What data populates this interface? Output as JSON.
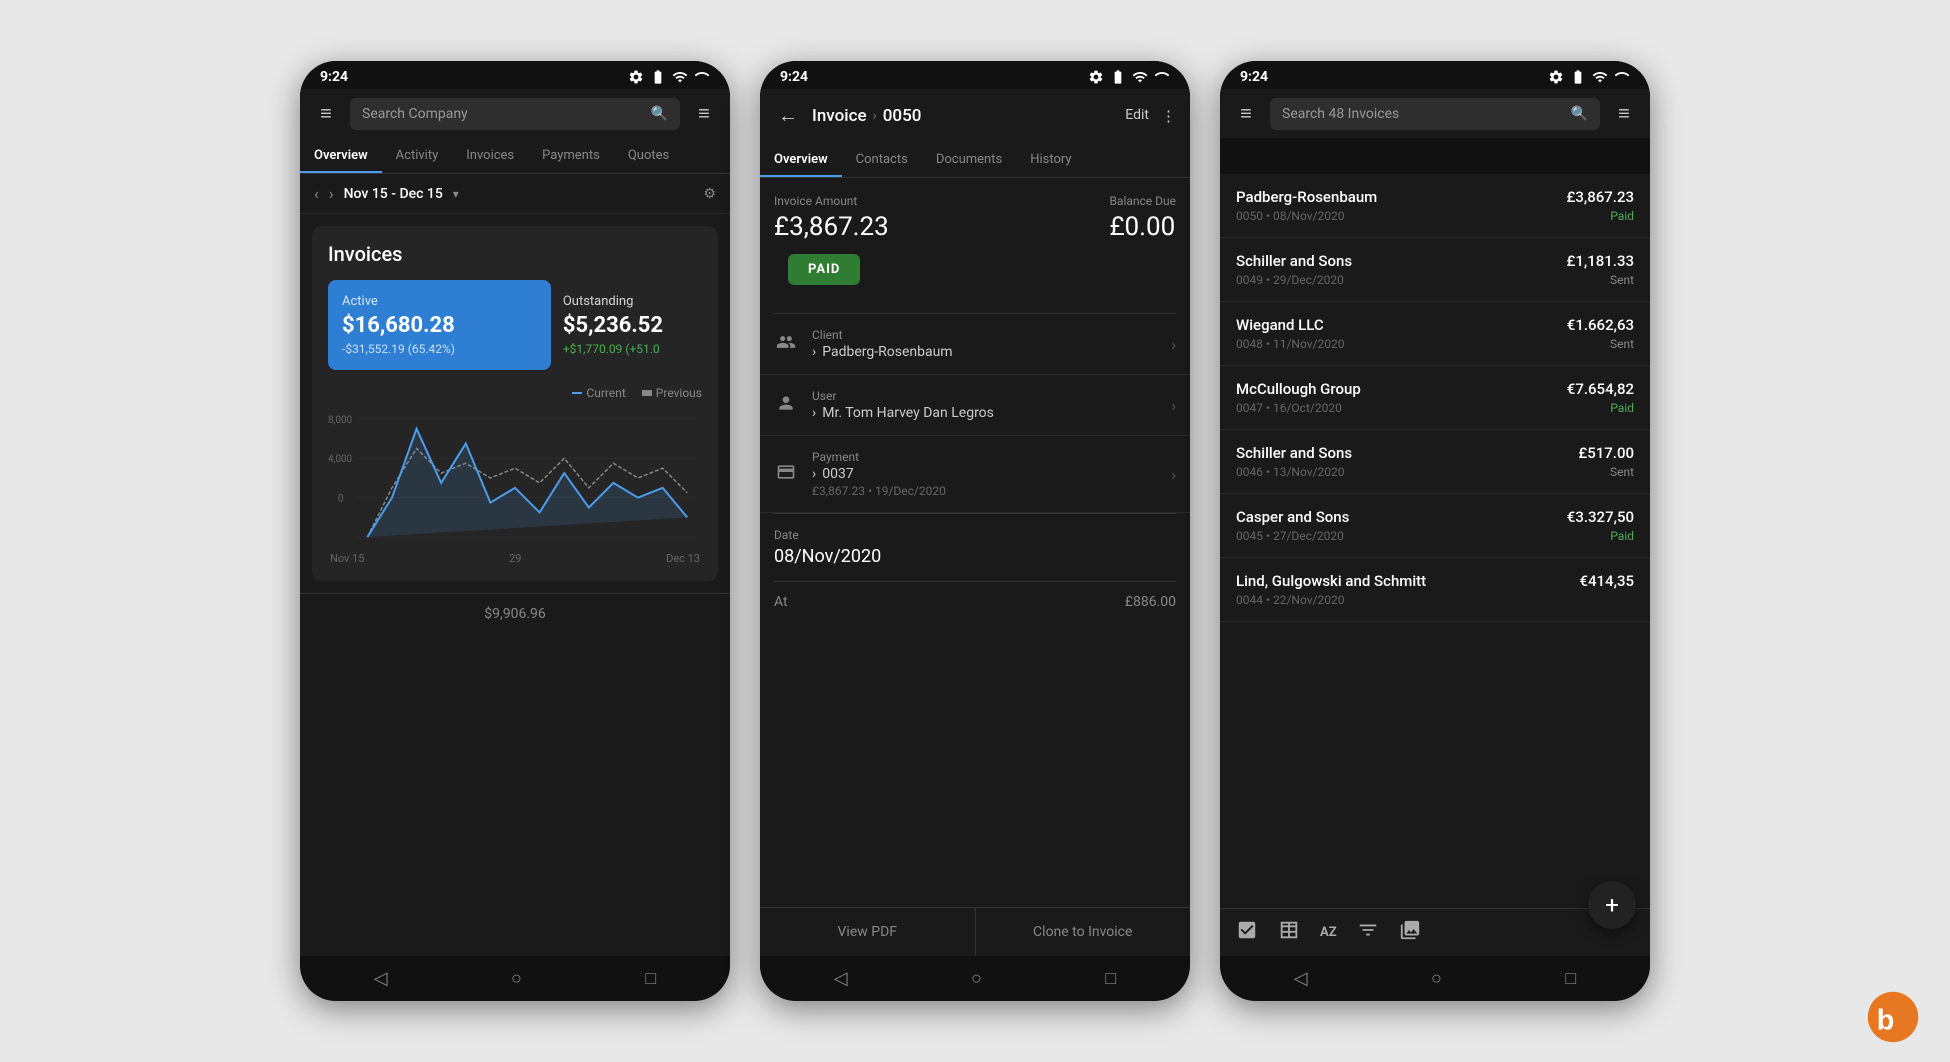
{
  "scene": {
    "background": "#e8e8e8"
  },
  "phone1": {
    "statusBar": {
      "time": "9:24",
      "icons": [
        "settings",
        "battery",
        "wifi",
        "signal"
      ]
    },
    "topBar": {
      "searchPlaceholder": "Search Company",
      "menuIcon": "≡",
      "searchIcon": "🔍"
    },
    "tabs": [
      {
        "label": "Overview",
        "active": true
      },
      {
        "label": "Activity",
        "active": false
      },
      {
        "label": "Invoices",
        "active": false
      },
      {
        "label": "Payments",
        "active": false
      },
      {
        "label": "Quotes",
        "active": false
      }
    ],
    "dateBar": {
      "range": "Nov 15 - Dec 15",
      "settingsIcon": "⚙"
    },
    "card": {
      "title": "Invoices",
      "activeLabel": "Active",
      "activeValue": "$16,680.28",
      "activeSub": "-$31,552.19 (65.42%)",
      "outstandingLabel": "Outstanding",
      "outstandingValue": "$5,236.52",
      "outstandingSub": "+$1,770.09 (+51.0",
      "legendCurrent": "Current",
      "legendPrevious": "Previous",
      "chartYLabels": [
        "8,000",
        "4,000",
        "0"
      ],
      "chartXLabels": [
        "Nov 15",
        "29",
        "Dec 13"
      ]
    },
    "bottomAmount": "$9,906.96"
  },
  "phone2": {
    "statusBar": {
      "time": "9:24"
    },
    "header": {
      "backIcon": "←",
      "titlePrefix": "Invoice",
      "separator": "›",
      "invoiceNumber": "0050",
      "editLabel": "Edit",
      "moreIcon": "⋮"
    },
    "tabs": [
      {
        "label": "Overview",
        "active": true
      },
      {
        "label": "Contacts",
        "active": false
      },
      {
        "label": "Documents",
        "active": false
      },
      {
        "label": "History",
        "active": false
      }
    ],
    "invoiceAmount": {
      "amountLabel": "Invoice Amount",
      "amountValue": "£3,867.23",
      "balanceLabel": "Balance Due",
      "balanceValue": "£0.00"
    },
    "paidBadge": "PAID",
    "rows": [
      {
        "icon": "👥",
        "label": "Client",
        "separator": "›",
        "value": "Padberg-Rosenbaum",
        "sub": ""
      },
      {
        "icon": "👤",
        "label": "User",
        "separator": "›",
        "value": "Mr. Tom Harvey Dan Legros",
        "sub": ""
      },
      {
        "icon": "💳",
        "label": "Payment",
        "separator": "›",
        "value": "0037",
        "sub": "£3,867.23 • 19/Dec/2020"
      }
    ],
    "dateField": {
      "label": "Date",
      "value": "08/Nov/2020"
    },
    "atLabel": "At",
    "atValue": "£886.00",
    "actions": [
      {
        "label": "View PDF"
      },
      {
        "label": "Clone to Invoice"
      }
    ]
  },
  "phone3": {
    "statusBar": {
      "time": "9:24"
    },
    "topBar": {
      "menuIcon": "≡",
      "searchPlaceholder": "Search 48 Invoices",
      "searchIcon": "🔍",
      "filterIcon": "≡"
    },
    "invoices": [
      {
        "company": "Padberg-Rosenbaum",
        "meta": "0050 • 08/Nov/2020",
        "amount": "£3,867.23",
        "status": "Paid",
        "statusType": "paid"
      },
      {
        "company": "Schiller and Sons",
        "meta": "0049 • 29/Dec/2020",
        "amount": "£1,181.33",
        "status": "Sent",
        "statusType": "sent"
      },
      {
        "company": "Wiegand LLC",
        "meta": "0048 • 11/Nov/2020",
        "amount": "€1.662,63",
        "status": "Sent",
        "statusType": "sent"
      },
      {
        "company": "McCullough Group",
        "meta": "0047 • 16/Oct/2020",
        "amount": "€7.654,82",
        "status": "Paid",
        "statusType": "paid"
      },
      {
        "company": "Schiller and Sons",
        "meta": "0046 • 13/Nov/2020",
        "amount": "£517.00",
        "status": "Sent",
        "statusType": "sent"
      },
      {
        "company": "Casper and Sons",
        "meta": "0045 • 27/Dec/2020",
        "amount": "€3.327,50",
        "status": "Paid",
        "statusType": "paid"
      },
      {
        "company": "Lind, Gulgowski and Schmitt",
        "meta": "0044 • 22/Nov/2020",
        "amount": "€414,35",
        "status": "",
        "statusType": ""
      }
    ],
    "fab": "+",
    "toolbar": {
      "checkIcon": "☑",
      "tableIcon": "⊞",
      "sortIcon": "AZ",
      "filterIcon": "≡",
      "galleryIcon": "⊟"
    }
  }
}
